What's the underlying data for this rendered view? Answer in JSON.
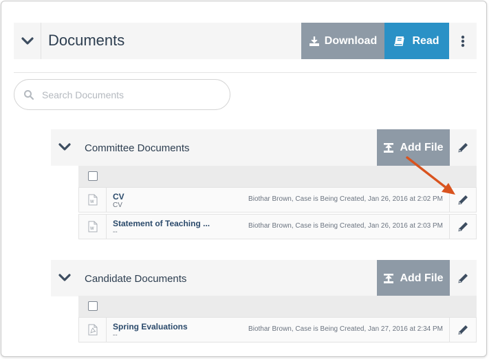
{
  "header": {
    "title": "Documents",
    "download_label": "Download",
    "read_label": "Read"
  },
  "search": {
    "placeholder": "Search Documents"
  },
  "groups": [
    {
      "title": "Committee Documents",
      "add_label": "Add File",
      "files": [
        {
          "name": "CV",
          "sub": "CV",
          "meta": "Biothar Brown, Case is Being Created, Jan 26, 2016 at 2:02 PM",
          "type": "word"
        },
        {
          "name": "Statement of Teaching ...",
          "sub": "--",
          "meta": "Biothar Brown, Case is Being Created, Jan 26, 2016 at 2:03 PM",
          "type": "word"
        }
      ]
    },
    {
      "title": "Candidate Documents",
      "add_label": "Add File",
      "files": [
        {
          "name": "Spring Evaluations",
          "sub": "--",
          "meta": "Biothar Brown, Case is Being Created, Jan 27, 2016 at 2:34 PM",
          "type": "pdf"
        }
      ]
    }
  ],
  "colors": {
    "accent": "#2a91c6",
    "button_gray": "#8e9aa6",
    "text": "#2d3e50",
    "annotation_arrow": "#d9531e"
  },
  "icons": [
    "chevron-down-icon",
    "download-icon",
    "book-icon",
    "more-vertical-icon",
    "search-icon",
    "upload-icon",
    "pencil-icon",
    "word-file-icon",
    "pdf-file-icon",
    "annotation-arrow"
  ]
}
